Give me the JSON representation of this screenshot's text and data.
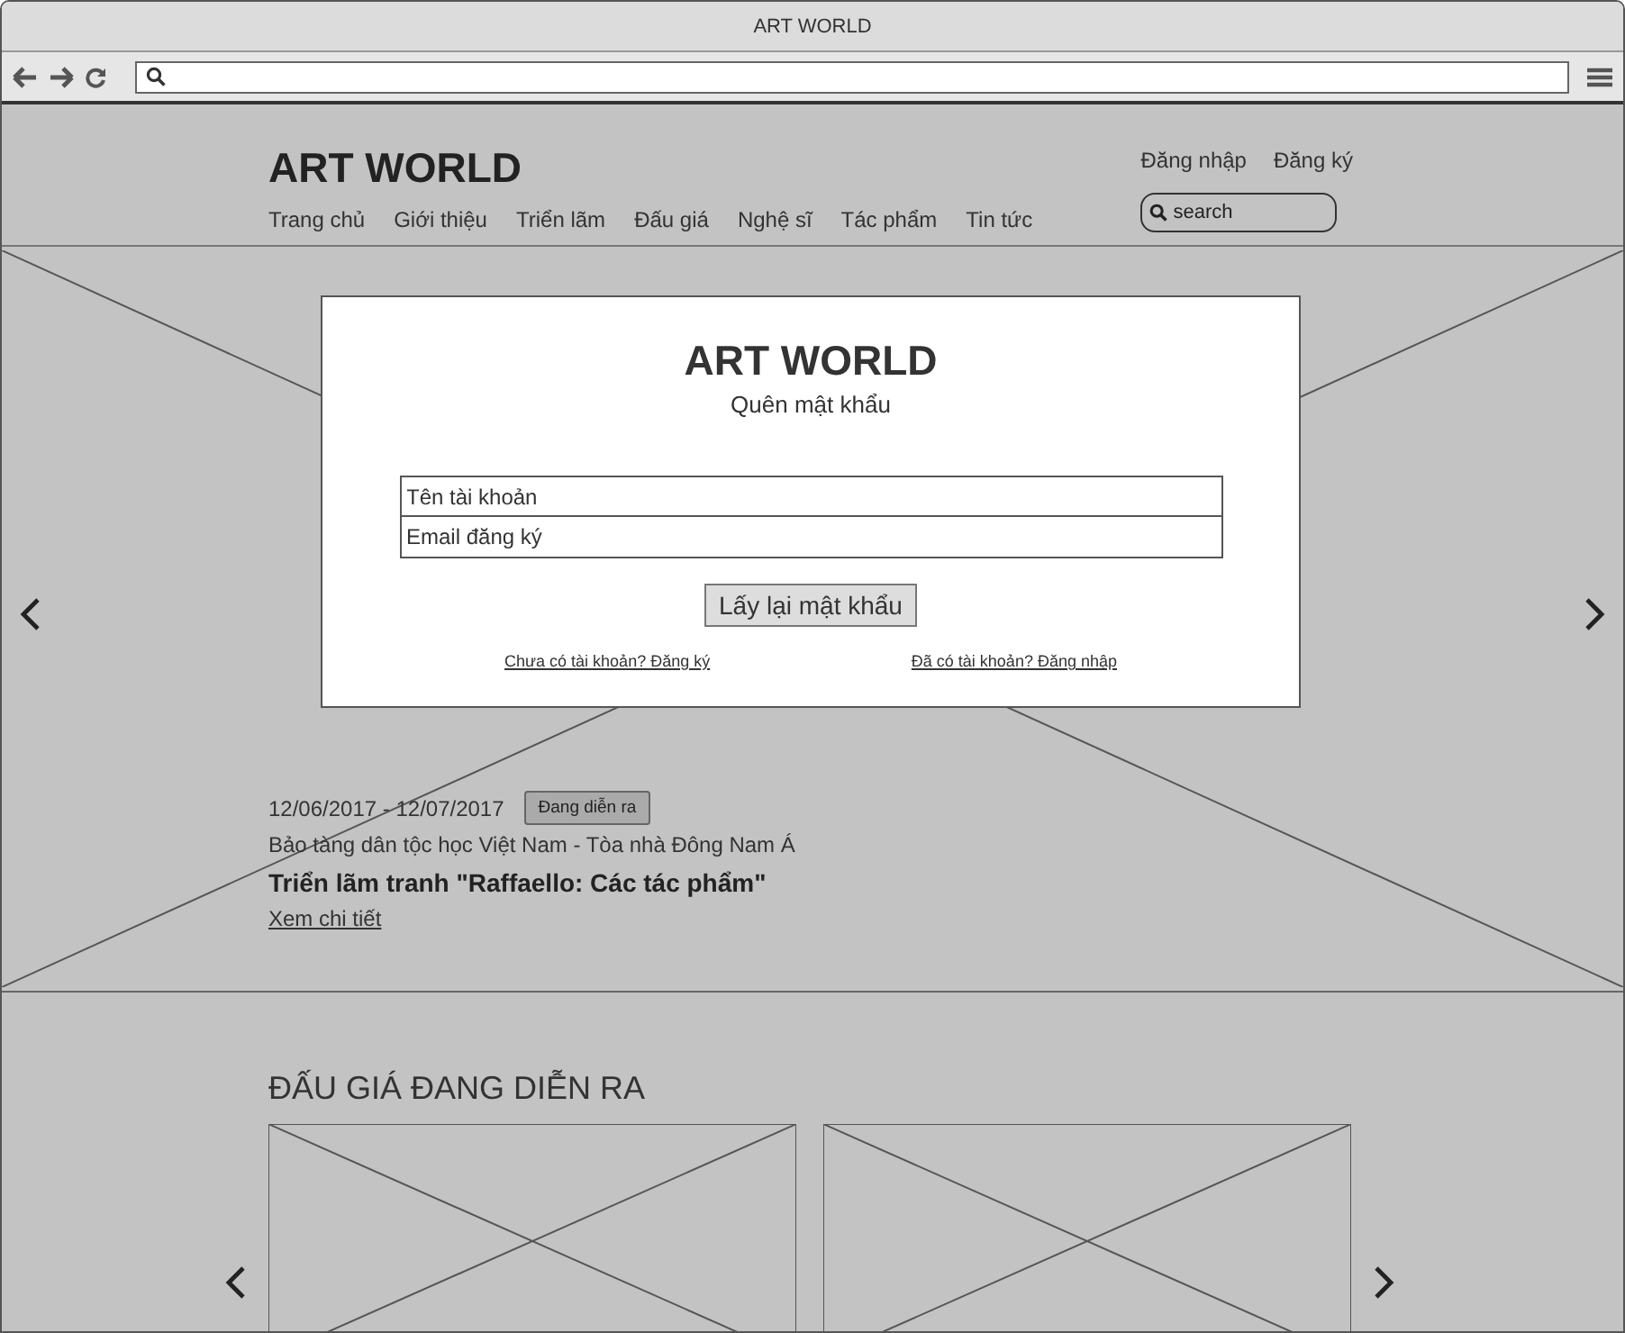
{
  "window": {
    "title": "ART WORLD"
  },
  "header": {
    "logo": "ART WORLD",
    "nav": [
      "Trang chủ",
      "Giới thiệu",
      "Triển lãm",
      "Đấu giá",
      "Nghệ sĩ",
      "Tác phẩm",
      "Tin tức"
    ],
    "account_links": [
      "Đăng nhập",
      "Đăng ký"
    ],
    "search": {
      "placeholder": "search"
    }
  },
  "hero": {
    "dialog": {
      "title": "ART WORLD",
      "subtitle": "Quên mật khẩu",
      "fields": [
        {
          "placeholder": "Tên tài khoản"
        },
        {
          "placeholder": "Email đăng ký"
        }
      ],
      "button": "Lấy lại mật khẩu",
      "links": [
        "Chưa có tài khoản? Đăng ký",
        "Đã có tài khoản? Đăng nhập"
      ]
    },
    "event": {
      "dates": "12/06/2017 - 12/07/2017",
      "status": "Đang diễn ra",
      "venue": "Bảo tàng dân tộc học Việt Nam - Tòa nhà Đông Nam Á",
      "title": "Triển lãm tranh \"Raffaello: Các tác phẩm\"",
      "link": "Xem chi tiết"
    }
  },
  "auctions": {
    "title": "ĐẤU GIÁ ĐANG DIỄN RA"
  }
}
